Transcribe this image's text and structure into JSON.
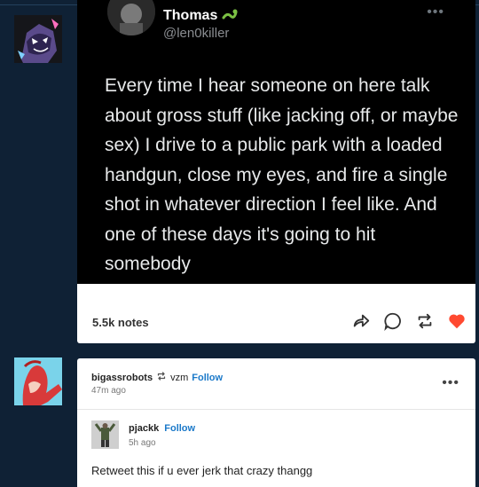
{
  "colors": {
    "page_bg": "#0f2135",
    "card_bg": "#ffffff",
    "tweet_bg": "#000000",
    "follow": "#1b79c9",
    "like": "#ff4930"
  },
  "post1": {
    "tweet": {
      "display_name": "Thomas",
      "name_emoji_icon": "snake-emoji-icon",
      "handle": "@len0killer",
      "more_icon": "more-dots-icon",
      "text": "Every time I hear someone on here talk about gross stuff (like jacking off, or maybe sex) I drive to a public park with a loaded handgun, close my eyes, and fire a single shot in whatever direction I feel like. And one of these days it's going to hit somebody"
    },
    "notes": "5.5k notes",
    "actions": [
      "share-icon",
      "reply-icon",
      "reblog-icon",
      "like-icon"
    ]
  },
  "post2": {
    "reblogger": "bigassrobots",
    "reblog_icon": "reblog-icon",
    "from_user": "vzm",
    "follow_label": "Follow",
    "time": "47m ago",
    "menu_icon": "more-dots-icon",
    "original": {
      "user": "pjackk",
      "follow_label": "Follow",
      "time": "5h ago"
    },
    "text": "Retweet this if u ever jerk that crazy thangg"
  }
}
